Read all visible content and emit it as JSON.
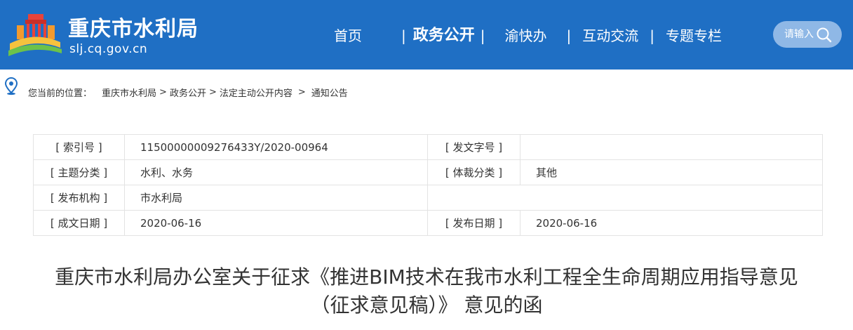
{
  "header": {
    "site_name": "重庆市水利局",
    "site_domain": "slj.cq.gov.cn",
    "bg_color": "#1f6fc4"
  },
  "nav": {
    "items": [
      {
        "label": "首页"
      },
      {
        "label": "政务公开",
        "active": true
      },
      {
        "label": "渝快办"
      },
      {
        "label": "互动交流"
      },
      {
        "label": "专题专栏"
      }
    ],
    "separator": "|"
  },
  "search": {
    "placeholder": "请输入",
    "icon": "search-icon"
  },
  "breadcrumb": {
    "icon": "location-pin-icon",
    "prefix": "您当前的位置：",
    "items": [
      "重庆市水利局",
      "政务公开",
      "法定主动公开内容",
      "通知公告"
    ],
    "separator": ">"
  },
  "info": {
    "index_label": "[ 索引号 ]",
    "index_value": "11500000009276433Y/2020-00964",
    "doc_no_label": "[ 发文字号 ]",
    "doc_no_value": "",
    "topic_label": "[ 主题分类 ]",
    "topic_value": "水利、水务",
    "genre_label": "[ 体裁分类 ]",
    "genre_value": "其他",
    "issuer_label": "[ 发布机构 ]",
    "issuer_value": "市水利局",
    "created_label": "[ 成文日期 ]",
    "created_value": "2020-06-16",
    "published_label": "[ 发布日期 ]",
    "published_value": "2020-06-16"
  },
  "article": {
    "title_line1": "重庆市水利局办公室关于征求《推进BIM技术在我市水利工程全生命周期应用指导意见",
    "title_line2": "（征求意见稿）》 意见的函"
  }
}
